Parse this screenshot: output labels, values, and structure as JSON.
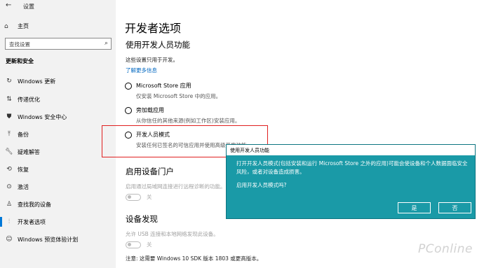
{
  "window": {
    "title": "设置"
  },
  "sidebar": {
    "home_label": "主页",
    "search_value": "查找设置",
    "section_label": "更新和安全",
    "items": [
      {
        "label": "Windows 更新",
        "icon": "refresh-icon"
      },
      {
        "label": "传递优化",
        "icon": "delivery-icon"
      },
      {
        "label": "Windows 安全中心",
        "icon": "shield-icon"
      },
      {
        "label": "备份",
        "icon": "backup-icon"
      },
      {
        "label": "疑难解答",
        "icon": "wrench-icon"
      },
      {
        "label": "恢复",
        "icon": "recovery-icon"
      },
      {
        "label": "激活",
        "icon": "activation-icon"
      },
      {
        "label": "查找我的设备",
        "icon": "person-pin-icon"
      },
      {
        "label": "开发者选项",
        "icon": "developer-icon",
        "active": true
      },
      {
        "label": "Windows 预览体验计划",
        "icon": "insider-icon"
      }
    ]
  },
  "main": {
    "title": "开发者选项",
    "dev_features": {
      "heading": "使用开发人员功能",
      "desc": "这些设置只用于开发。",
      "link": "了解更多信息",
      "options": [
        {
          "title": "Microsoft Store 应用",
          "sub": "仅安装 Microsoft Store 中的应用。"
        },
        {
          "title": "旁加载应用",
          "sub": "从你信任的其他来源(例如工作区)安装应用。"
        },
        {
          "title": "开发人员模式",
          "sub": "安装任何已签名的可信应用并使用高级开发功能。"
        }
      ]
    },
    "device_portal": {
      "heading": "启用设备门户",
      "desc": "启用通过局域网连接进行远程诊断的功能。",
      "toggle_label": "关"
    },
    "device_discovery": {
      "heading": "设备发现",
      "desc": "允许 USB 连接和本地网络发现此设备。",
      "toggle_label": "关",
      "note": "注意: 这需要 Windows 10 SDK 版本 1803 或更高版本。"
    }
  },
  "dialog": {
    "title": "使用开发人员功能",
    "body": "打开开发人员模式(包括安装和运行 Microsoft Store 之外的应用)可能会使设备和个人数据面临安全风险，或者对设备造成损害。",
    "question": "启用开发人员模式吗?",
    "yes_label": "是",
    "no_label": "否",
    "accent": "#1a9aa7"
  },
  "watermark": "PConline"
}
